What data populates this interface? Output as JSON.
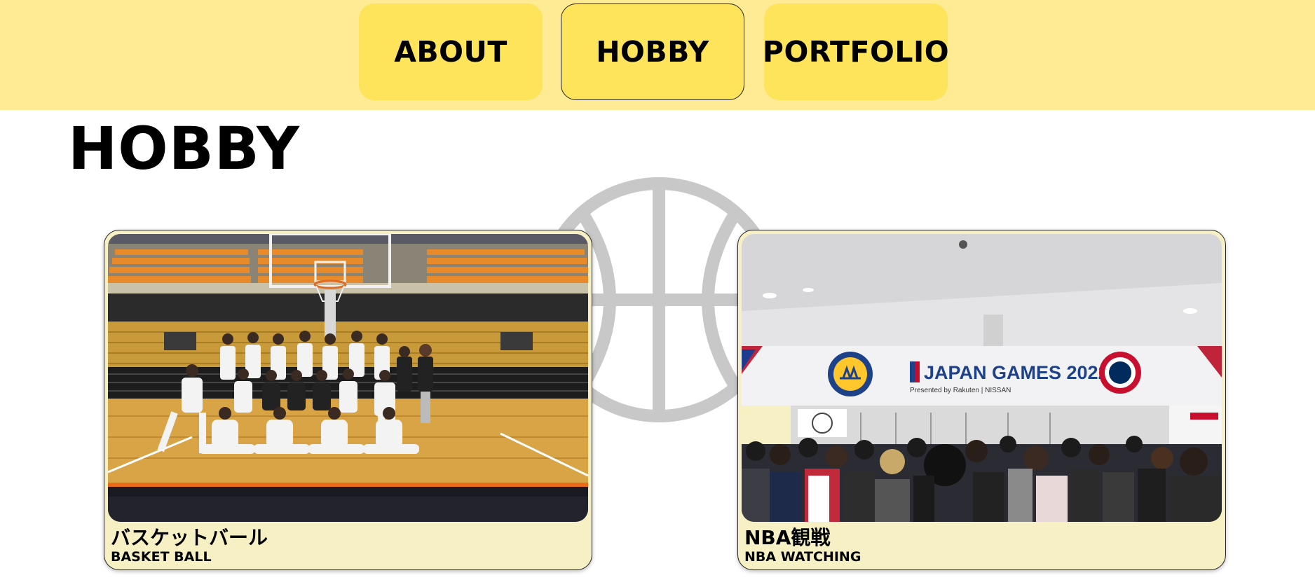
{
  "nav": {
    "items": [
      {
        "label": "ABOUT",
        "active": false
      },
      {
        "label": "HOBBY",
        "active": true
      },
      {
        "label": "PORTFOLIO",
        "active": false
      }
    ]
  },
  "page": {
    "title": "HOBBY"
  },
  "cards": [
    {
      "title": "バスケットバール",
      "subtitle": "BASKET BALL"
    },
    {
      "title": "NBA観戦",
      "subtitle": "NBA WATCHING",
      "photo_text": {
        "left_logo": "GOLDEN STATE WARRIORS",
        "banner": "JAPAN GAMES 2022",
        "presented": "Presented by Rakuten | NISSAN",
        "right_logo": "WASHINGTON WIZARDS"
      }
    }
  ],
  "colors": {
    "header_bg": "#feeb94",
    "nav_button": "#fee45a",
    "card_bg": "#f6f0c4",
    "watermark": "#c8c8c8"
  },
  "icons": {
    "watermark": "basketball-icon"
  }
}
